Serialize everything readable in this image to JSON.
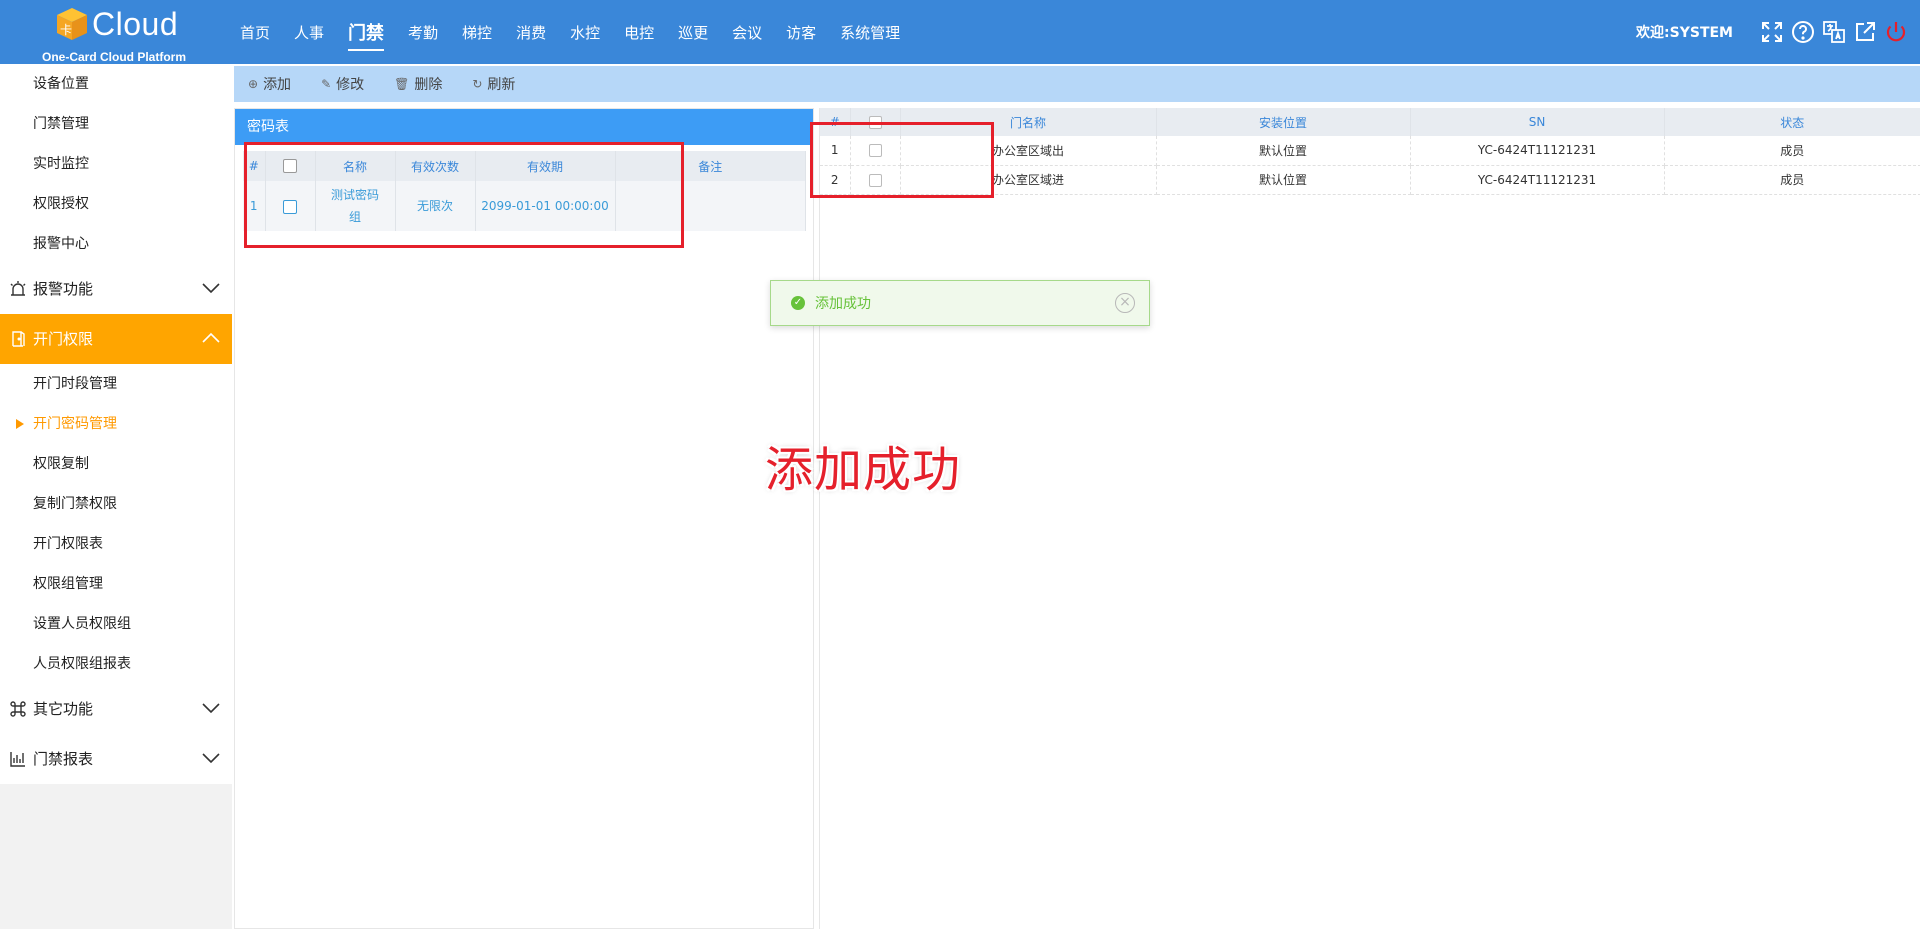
{
  "header": {
    "logo_text": "Cloud",
    "logo_sub": "One-Card Cloud Platform",
    "nav": [
      "首页",
      "人事",
      "门禁",
      "考勤",
      "梯控",
      "消费",
      "水控",
      "电控",
      "巡更",
      "会议",
      "访客",
      "系统管理"
    ],
    "active_nav": "门禁",
    "welcome": "欢迎:SYSTEM",
    "icons": [
      "fullscreen-icon",
      "help-icon",
      "translate-icon",
      "external-link-icon",
      "power-icon"
    ]
  },
  "sidebar": {
    "top_items": [
      "设备位置",
      "门禁管理",
      "实时监控",
      "权限授权",
      "报警中心"
    ],
    "group_alarm": "报警功能",
    "group_open": "开门权限",
    "open_items": [
      "开门时段管理",
      "开门密码管理",
      "权限复制",
      "复制门禁权限",
      "开门权限表",
      "权限组管理",
      "设置人员权限组",
      "人员权限组报表"
    ],
    "active_item": "开门密码管理",
    "group_other": "其它功能",
    "group_report": "门禁报表",
    "active_color": "#ffa500"
  },
  "toolbar": {
    "add": "添加",
    "edit": "修改",
    "delete": "删除",
    "refresh": "刷新"
  },
  "password_table": {
    "title": "密码表",
    "headers": [
      "#",
      "",
      "名称",
      "有效次数",
      "有效期",
      "备注"
    ],
    "rows": [
      {
        "idx": "1",
        "name": "测试密码组",
        "count": "无限次",
        "expiry": "2099-01-01 00:00:00",
        "note": ""
      }
    ]
  },
  "door_table": {
    "headers": [
      "#",
      "",
      "门名称",
      "安装位置",
      "SN",
      "状态"
    ],
    "rows": [
      {
        "idx": "1",
        "name": "办公室区域出",
        "location": "默认位置",
        "sn": "YC-6424T11121231",
        "status": "成员"
      },
      {
        "idx": "2",
        "name": "办公室区域进",
        "location": "默认位置",
        "sn": "YC-6424T11121231",
        "status": "成员"
      }
    ]
  },
  "toast": {
    "message": "添加成功"
  },
  "annotation": "添加成功"
}
